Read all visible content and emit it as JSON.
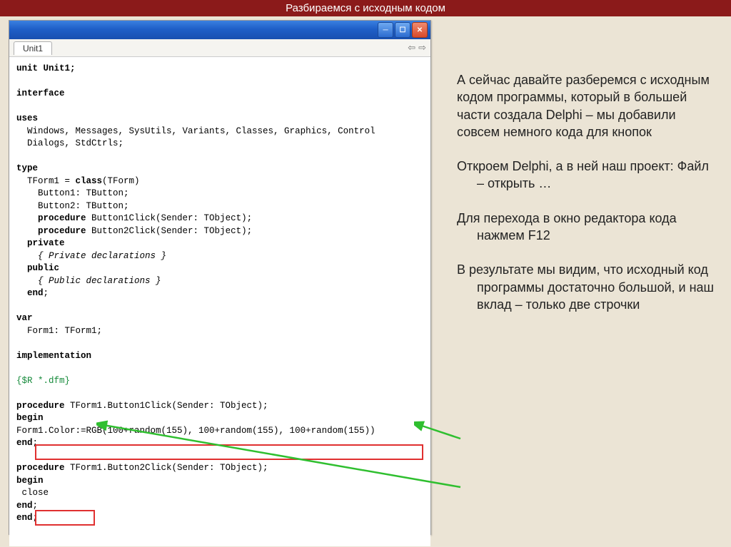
{
  "slide": {
    "title": "Разбираемся с исходным кодом"
  },
  "window": {
    "tab": "Unit1"
  },
  "code": {
    "l1": "unit Unit1;",
    "l2": "",
    "l3": "interface",
    "l4": "",
    "l5": "uses",
    "l6": "  Windows, Messages, SysUtils, Variants, Classes, Graphics, Control",
    "l7": "  Dialogs, StdCtrls;",
    "l8": "",
    "l9": "type",
    "l10": "  TForm1 = class(TForm)",
    "l11": "    Button1: TButton;",
    "l12": "    Button2: TButton;",
    "l13": "    procedure Button1Click(Sender: TObject);",
    "l14": "    procedure Button2Click(Sender: TObject);",
    "l15": "  private",
    "l16": "    { Private declarations }",
    "l17": "  public",
    "l18": "    { Public declarations }",
    "l19": "  end;",
    "l20": "",
    "l21": "var",
    "l22": "  Form1: TForm1;",
    "l23": "",
    "l24": "implementation",
    "l25": "",
    "l26": "{$R *.dfm}",
    "l27": "",
    "l28": "procedure TForm1.Button1Click(Sender: TObject);",
    "l29": "begin",
    "l30": "Form1.Color:=RGB(100+random(155), 100+random(155), 100+random(155))",
    "l31": "end;",
    "l32": "",
    "l33": "procedure TForm1.Button2Click(Sender: TObject);",
    "l34": "begin",
    "l35": " close",
    "l36": "end;",
    "l37": "end;"
  },
  "text": {
    "p1": "  А сейчас давайте разберемся с исходным кодом программы, который в большей части создала Delphi – мы добавили совсем немного кода для кнопок",
    "p2": "Откроем  Delphi, а в ней наш проект: Файл – открыть …",
    "p3": "Для перехода в окно редактора кода нажмем F12",
    "p4": "В результате мы видим, что исходный код программы достаточно большой, и наш вклад – только две строчки"
  }
}
